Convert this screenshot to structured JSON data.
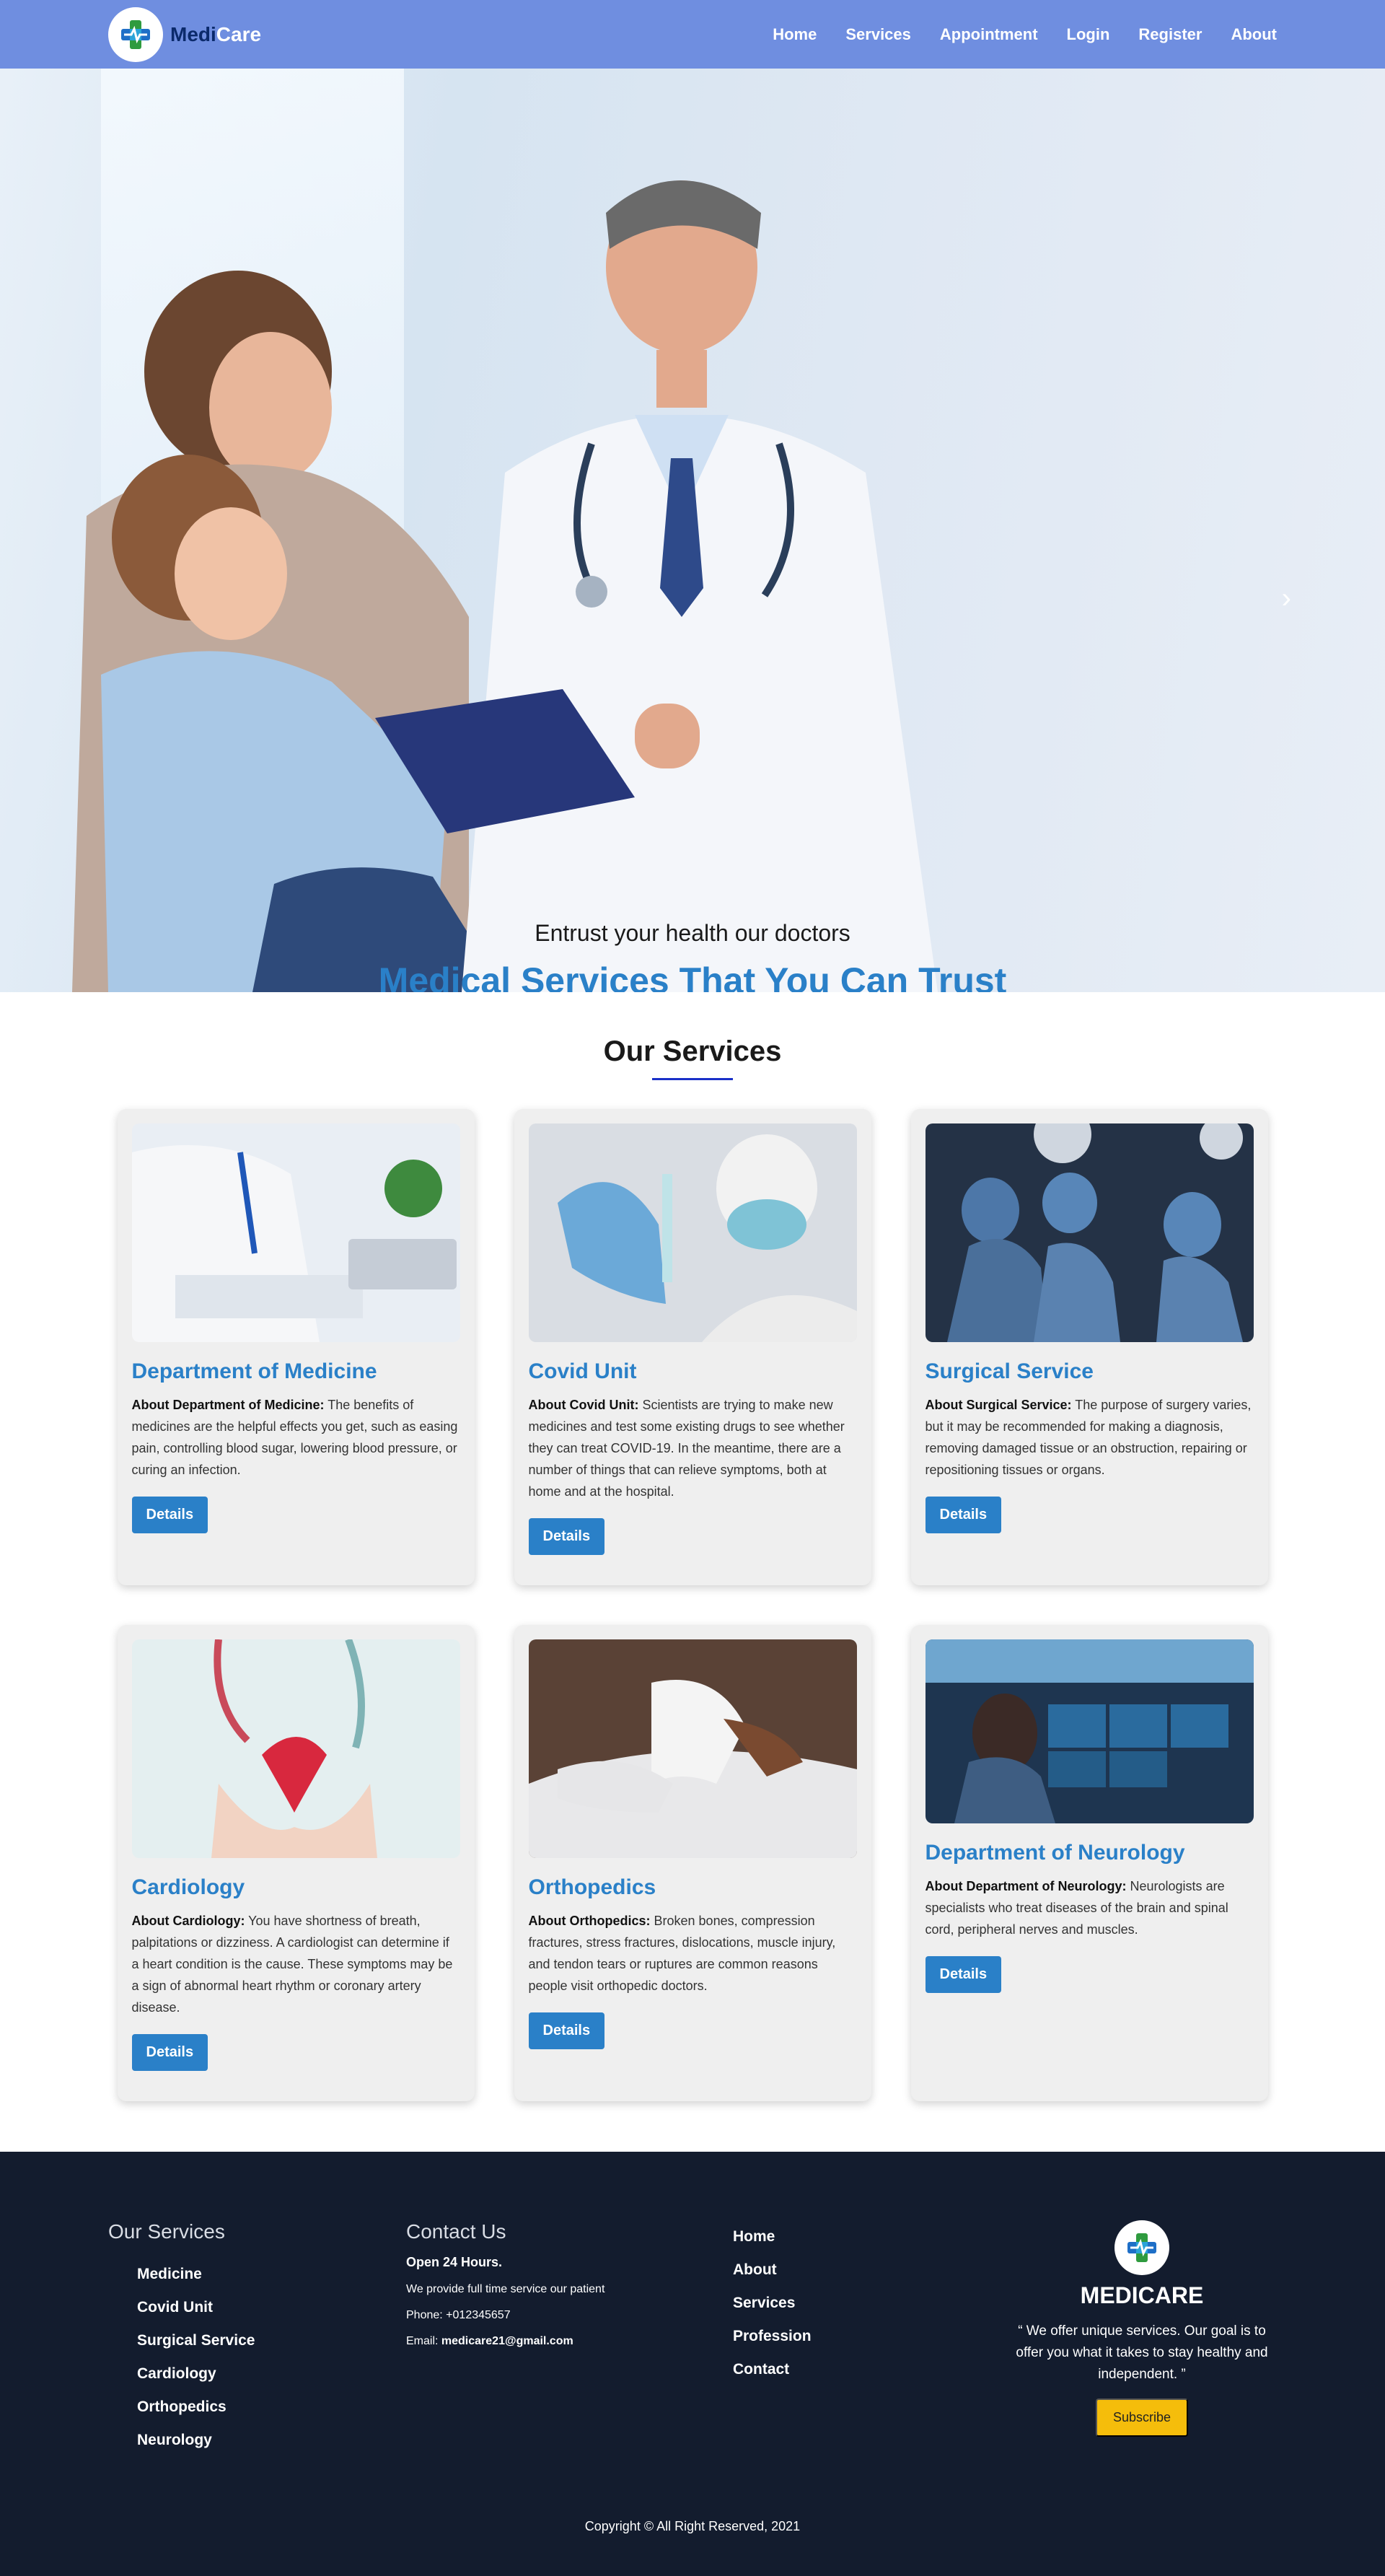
{
  "brand": {
    "part1": "Medi",
    "part2": "Care"
  },
  "nav": {
    "items": [
      "Home",
      "Services",
      "Appointment",
      "Login",
      "Register",
      "About"
    ]
  },
  "hero": {
    "subtitle": "Entrust your health our doctors",
    "title": "Medical Services That You Can Trust",
    "slides": 3,
    "active_slide": 1,
    "next_icon": "chevron-right-icon"
  },
  "services": {
    "title": "Our Services",
    "button_label": "Details",
    "cards": [
      {
        "title": "Department of Medicine",
        "label": "About Department of Medicine:",
        "text": "The benefits of medicines are the helpful effects you get, such as easing pain, controlling blood sugar, lowering blood pressure, or curing an infection."
      },
      {
        "title": "Covid Unit",
        "label": "About Covid Unit:",
        "text": "Scientists are trying to make new medicines and test some existing drugs to see whether they can treat COVID-19. In the meantime, there are a number of things that can relieve symptoms, both at home and at the hospital."
      },
      {
        "title": "Surgical Service",
        "label": "About Surgical Service:",
        "text": "The purpose of surgery varies, but it may be recommended for making a diagnosis, removing damaged tissue or an obstruction, repairing or repositioning tissues or organs."
      },
      {
        "title": "Cardiology",
        "label": "About Cardiology:",
        "text": "You have shortness of breath, palpitations or dizziness. A cardiologist can determine if a heart condition is the cause. These symptoms may be a sign of abnormal heart rhythm or coronary artery disease."
      },
      {
        "title": "Orthopedics",
        "label": "About Orthopedics:",
        "text": "Broken bones, compression fractures, stress fractures, dislocations, muscle injury, and tendon tears or ruptures are common reasons people visit orthopedic doctors."
      },
      {
        "title": "Department of Neurology",
        "label": "About Department of Neurology:",
        "text": "Neurologists are specialists who treat diseases of the brain and spinal cord, peripheral nerves and muscles."
      }
    ]
  },
  "footer": {
    "services_title": "Our Services",
    "services": [
      "Medicine",
      "Covid Unit",
      "Surgical Service",
      "Cardiology",
      "Orthopedics",
      "Neurology"
    ],
    "contact_title": "Contact Us",
    "hours": "Open 24 Hours.",
    "note": "We provide full time service our patient",
    "phone_label": "Phone:",
    "phone": "+012345657",
    "email_label": "Email:",
    "email": "medicare21@gmail.com",
    "links": [
      "Home",
      "About",
      "Services",
      "Profession",
      "Contact"
    ],
    "brand": "MEDICARE",
    "quote": "“ We offer unique services. Our goal is to offer you what it takes to stay healthy and independent. ”",
    "subscribe_label": "Subscribe",
    "copyright": "Copyright © All Right Reserved, 2021"
  },
  "colors": {
    "nav_bg": "#6f8ee0",
    "accent": "#2a80c8",
    "footer_bg": "#131c2e",
    "subscribe": "#f5bd0b"
  }
}
